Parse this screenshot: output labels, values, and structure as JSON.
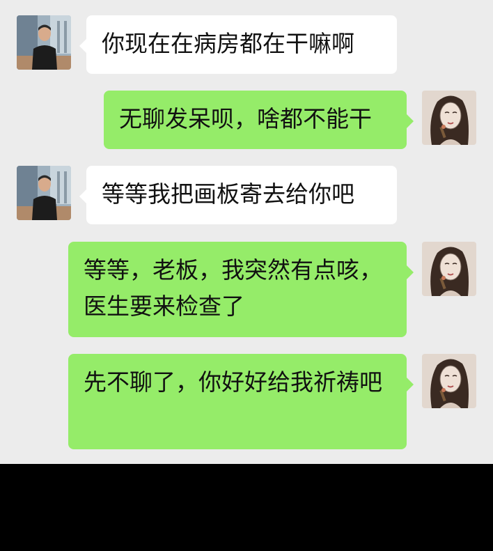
{
  "colors": {
    "background": "#ececec",
    "incoming_bubble": "#ffffff",
    "outgoing_bubble": "#95ec69",
    "text": "#111111"
  },
  "messages": [
    {
      "sender": "contact",
      "avatar": "man-avatar-icon",
      "text": "你现在在病房都在干嘛啊"
    },
    {
      "sender": "self",
      "avatar": "woman-avatar-icon",
      "text": "无聊发呆呗，啥都不能干"
    },
    {
      "sender": "contact",
      "avatar": "man-avatar-icon",
      "text": "等等我把画板寄去给你吧"
    },
    {
      "sender": "self",
      "avatar": "woman-avatar-icon",
      "text": "等等，老板，我突然有点咳，医生要来检查了"
    },
    {
      "sender": "self",
      "avatar": "woman-avatar-icon",
      "text": "先不聊了，你好好给我祈祷吧"
    }
  ]
}
